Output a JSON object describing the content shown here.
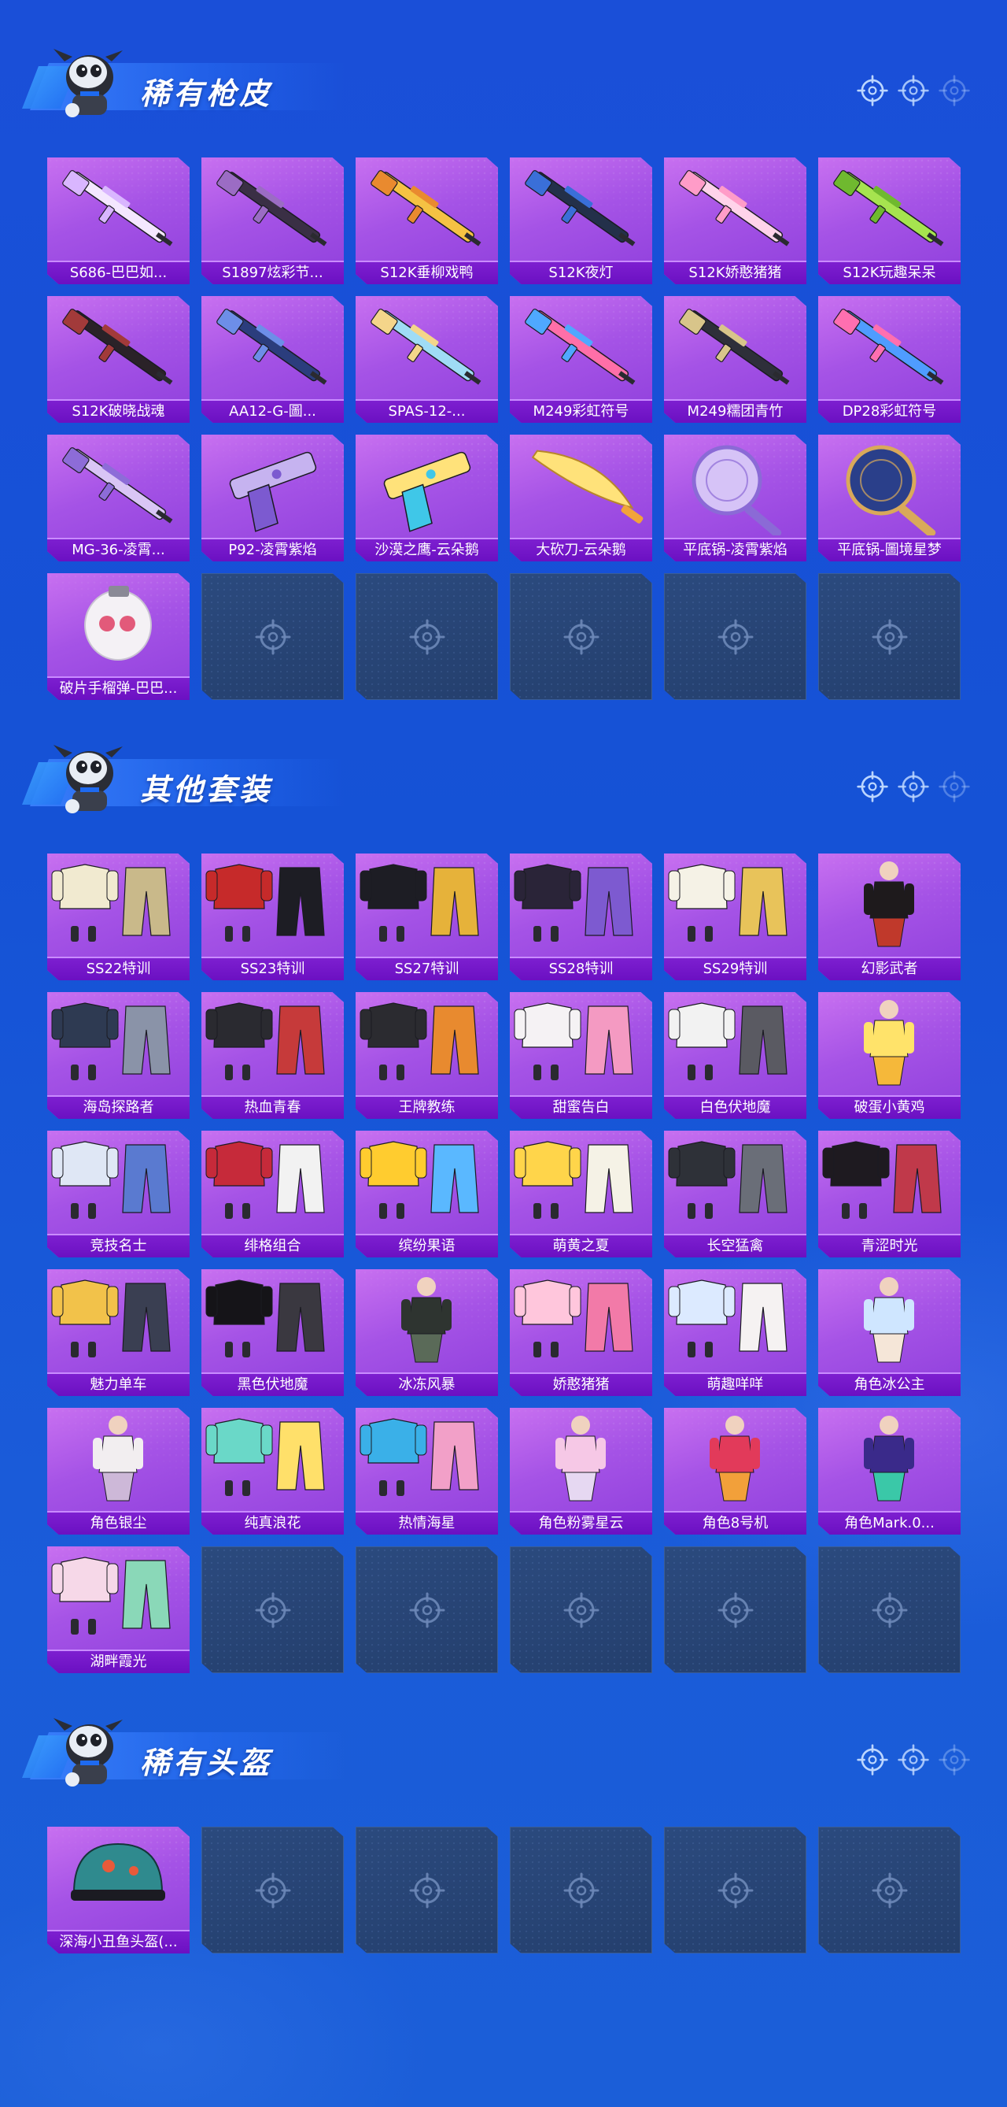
{
  "sections": [
    {
      "title": "稀有枪皮",
      "items": [
        {
          "label": "S686-巴巴如...",
          "kind": "gun",
          "colors": [
            "#f4e7ff",
            "#d9b6ff"
          ]
        },
        {
          "label": "S1897炫彩节...",
          "kind": "gun",
          "colors": [
            "#3a2f45",
            "#9b6cc4"
          ]
        },
        {
          "label": "S12K垂柳戏鸭",
          "kind": "gun",
          "colors": [
            "#f5c243",
            "#e98a2f"
          ]
        },
        {
          "label": "S12K夜灯",
          "kind": "gun",
          "colors": [
            "#23304a",
            "#3a6fd8"
          ]
        },
        {
          "label": "S12K娇憨猪猪",
          "kind": "gun",
          "colors": [
            "#ffd3ea",
            "#ff9cc8"
          ]
        },
        {
          "label": "S12K玩趣呆呆",
          "kind": "gun",
          "colors": [
            "#a6e44f",
            "#6fb92f"
          ]
        },
        {
          "label": "S12K破晓战魂",
          "kind": "gun",
          "colors": [
            "#2a2228",
            "#a23a3a"
          ]
        },
        {
          "label": "AA12-G-圖...",
          "kind": "gun",
          "colors": [
            "#2b3d7d",
            "#6d8ee8"
          ]
        },
        {
          "label": "SPAS-12-...",
          "kind": "gun",
          "colors": [
            "#9fdcf5",
            "#f4d58a"
          ]
        },
        {
          "label": "M249彩虹符号",
          "kind": "gun",
          "colors": [
            "#ff6fa8",
            "#4fa8ff"
          ]
        },
        {
          "label": "M249糯团青竹",
          "kind": "gun",
          "colors": [
            "#2e2f3a",
            "#d8c58a"
          ]
        },
        {
          "label": "DP28彩虹符号",
          "kind": "gun",
          "colors": [
            "#4f9cff",
            "#ff6fb0"
          ]
        },
        {
          "label": "MG-36-凌霄...",
          "kind": "gun",
          "colors": [
            "#d9c5f5",
            "#8d6cd8"
          ]
        },
        {
          "label": "P92-凌霄紫焰",
          "kind": "pistol",
          "colors": [
            "#c6b3f0",
            "#7c5ad0"
          ]
        },
        {
          "label": "沙漠之鹰-云朵鹅",
          "kind": "pistol",
          "colors": [
            "#ffe27a",
            "#3fc7e8"
          ]
        },
        {
          "label": "大砍刀-云朵鹅",
          "kind": "blade",
          "colors": [
            "#ffe27a",
            "#f2a33a"
          ]
        },
        {
          "label": "平底锅-凌霄紫焰",
          "kind": "pan",
          "colors": [
            "#d6c3f7",
            "#8b6ad6"
          ]
        },
        {
          "label": "平底锅-圖境星梦",
          "kind": "pan",
          "colors": [
            "#2a3f8a",
            "#d9a95a"
          ]
        },
        {
          "label": "破片手榴弹-巴巴...",
          "kind": "grenade",
          "colors": [
            "#f4f1f5",
            "#e25a7a"
          ]
        }
      ],
      "empty_slots": 5
    },
    {
      "title": "其他套装",
      "items": [
        {
          "label": "SS22特训",
          "kind": "outfit",
          "colors": [
            "#f1ead0",
            "#c9b98a"
          ]
        },
        {
          "label": "SS23特训",
          "kind": "outfit",
          "colors": [
            "#c62a2a",
            "#1d1d24"
          ]
        },
        {
          "label": "SS27特训",
          "kind": "outfit",
          "colors": [
            "#1d1d24",
            "#e6b23a"
          ]
        },
        {
          "label": "SS28特训",
          "kind": "outfit",
          "colors": [
            "#2a2438",
            "#7d5ad0"
          ]
        },
        {
          "label": "SS29特训",
          "kind": "outfit",
          "colors": [
            "#f5f2e6",
            "#e8c35a"
          ]
        },
        {
          "label": "幻影武者",
          "kind": "figure",
          "colors": [
            "#1e1a1c",
            "#c0392b"
          ]
        },
        {
          "label": "海岛探路者",
          "kind": "outfit",
          "colors": [
            "#2e3a52",
            "#8a93a8"
          ]
        },
        {
          "label": "热血青春",
          "kind": "outfit",
          "colors": [
            "#2a2a30",
            "#c63a3a"
          ]
        },
        {
          "label": "王牌教练",
          "kind": "outfit",
          "colors": [
            "#2b2b30",
            "#e88a2f"
          ]
        },
        {
          "label": "甜蜜告白",
          "kind": "outfit",
          "colors": [
            "#f5f2f4",
            "#f49ac2"
          ]
        },
        {
          "label": "白色伏地魔",
          "kind": "outfit",
          "colors": [
            "#f2f2f2",
            "#5a5a62"
          ]
        },
        {
          "label": "破蛋小黄鸡",
          "kind": "figure",
          "colors": [
            "#ffe36a",
            "#f5b83a"
          ]
        },
        {
          "label": "竞技名士",
          "kind": "outfit",
          "colors": [
            "#dfe7f5",
            "#5a7ad0"
          ]
        },
        {
          "label": "绯格组合",
          "kind": "outfit",
          "colors": [
            "#c62a3a",
            "#f2f2f2"
          ]
        },
        {
          "label": "缤纷果语",
          "kind": "outfit",
          "colors": [
            "#ffcc2f",
            "#5ab8ff"
          ]
        },
        {
          "label": "萌黄之夏",
          "kind": "outfit",
          "colors": [
            "#ffd54a",
            "#f5f2e6"
          ]
        },
        {
          "label": "长空猛禽",
          "kind": "outfit",
          "colors": [
            "#2e3138",
            "#6a6e78"
          ]
        },
        {
          "label": "青涩时光",
          "kind": "outfit",
          "colors": [
            "#1e1a20",
            "#c0394a"
          ]
        },
        {
          "label": "魅力单车",
          "kind": "outfit",
          "colors": [
            "#f2c24a",
            "#3a3f52"
          ]
        },
        {
          "label": "黑色伏地魔",
          "kind": "outfit",
          "colors": [
            "#151418",
            "#3a3840"
          ]
        },
        {
          "label": "冰冻风暴",
          "kind": "figure",
          "colors": [
            "#2e3430",
            "#5a6a58"
          ]
        },
        {
          "label": "娇憨猪猪",
          "kind": "outfit",
          "colors": [
            "#ffc6dc",
            "#f27aa8"
          ]
        },
        {
          "label": "萌趣咩咩",
          "kind": "outfit",
          "colors": [
            "#dceaff",
            "#f5f2f2"
          ]
        },
        {
          "label": "角色冰公主",
          "kind": "figure",
          "colors": [
            "#cfe6ff",
            "#f5e6d8"
          ]
        },
        {
          "label": "角色银尘",
          "kind": "figure",
          "colors": [
            "#f2eef0",
            "#cdb8d8"
          ]
        },
        {
          "label": "纯真浪花",
          "kind": "outfit",
          "colors": [
            "#6ad8c8",
            "#ffe06a"
          ]
        },
        {
          "label": "热情海星",
          "kind": "outfit",
          "colors": [
            "#3ab0e8",
            "#f2a0c8"
          ]
        },
        {
          "label": "角色粉雾星云",
          "kind": "figure",
          "colors": [
            "#f6c8e6",
            "#e6d8f2"
          ]
        },
        {
          "label": "角色8号机",
          "kind": "figure",
          "colors": [
            "#e23a5a",
            "#f2a03a"
          ]
        },
        {
          "label": "角色Mark.0...",
          "kind": "figure",
          "colors": [
            "#3a2a8a",
            "#3ac8a8"
          ]
        },
        {
          "label": "湖畔霞光",
          "kind": "outfit",
          "colors": [
            "#f6d8e8",
            "#8ad8b8"
          ]
        }
      ],
      "empty_slots": 5
    },
    {
      "title": "稀有头盔",
      "items": [
        {
          "label": "深海小丑鱼头盔(...",
          "kind": "helmet",
          "colors": [
            "#2f8a8e",
            "#e85a3a"
          ]
        }
      ],
      "empty_slots": 5
    }
  ],
  "theme": {
    "card_purple": "#a553e6",
    "label_purple": "#6b10c2",
    "empty_slot": "#243f6d",
    "background": "#1552d6"
  },
  "icons": {
    "header_decor": [
      "crosshair-icon",
      "crosshair-icon",
      "crosshair-icon"
    ],
    "empty_slot": "crosshair-icon",
    "mascot": "mascot-icon"
  }
}
